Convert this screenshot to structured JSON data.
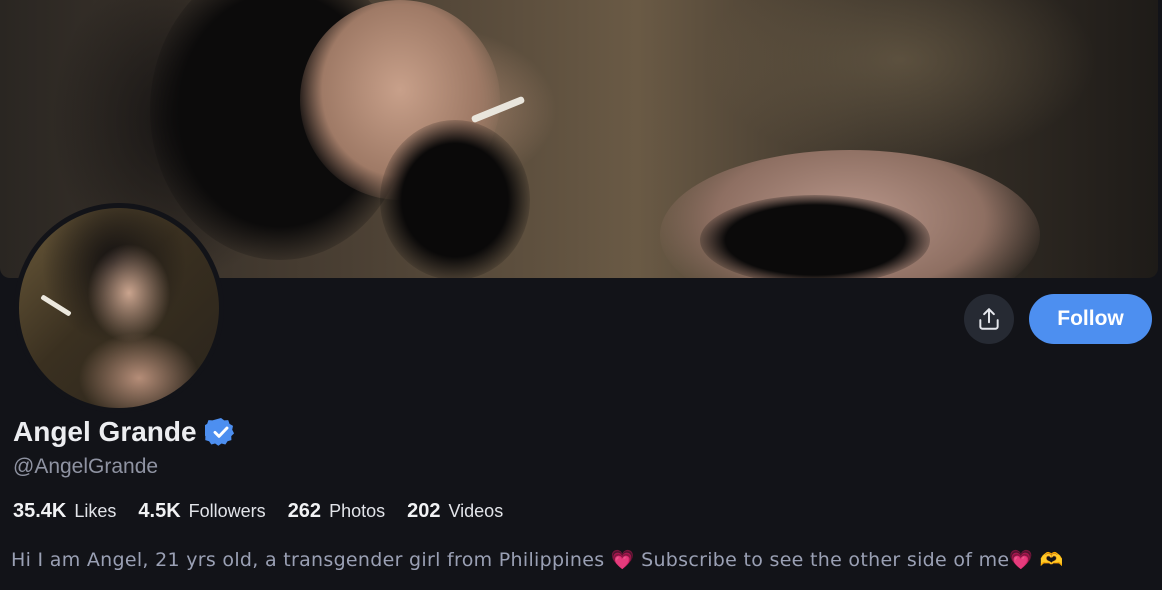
{
  "profile": {
    "display_name": "Angel Grande",
    "handle": "@AngelGrande",
    "verified": true,
    "verified_icon": "verified-badge-icon",
    "bio": "Hi I am Angel, 21 yrs old, a transgender girl from Philippines 💗  Subscribe to see the other side of me💗 🫶"
  },
  "actions": {
    "share_icon": "share-upload-icon",
    "follow_label": "Follow"
  },
  "stats": [
    {
      "value": "35.4K",
      "label": "Likes"
    },
    {
      "value": "4.5K",
      "label": "Followers"
    },
    {
      "value": "262",
      "label": "Photos"
    },
    {
      "value": "202",
      "label": "Videos"
    }
  ],
  "colors": {
    "background": "#121318",
    "accent": "#4d8ff0",
    "verified": "#4d8ff0",
    "text_primary": "#ecedf0",
    "text_secondary": "#8f93a2"
  }
}
